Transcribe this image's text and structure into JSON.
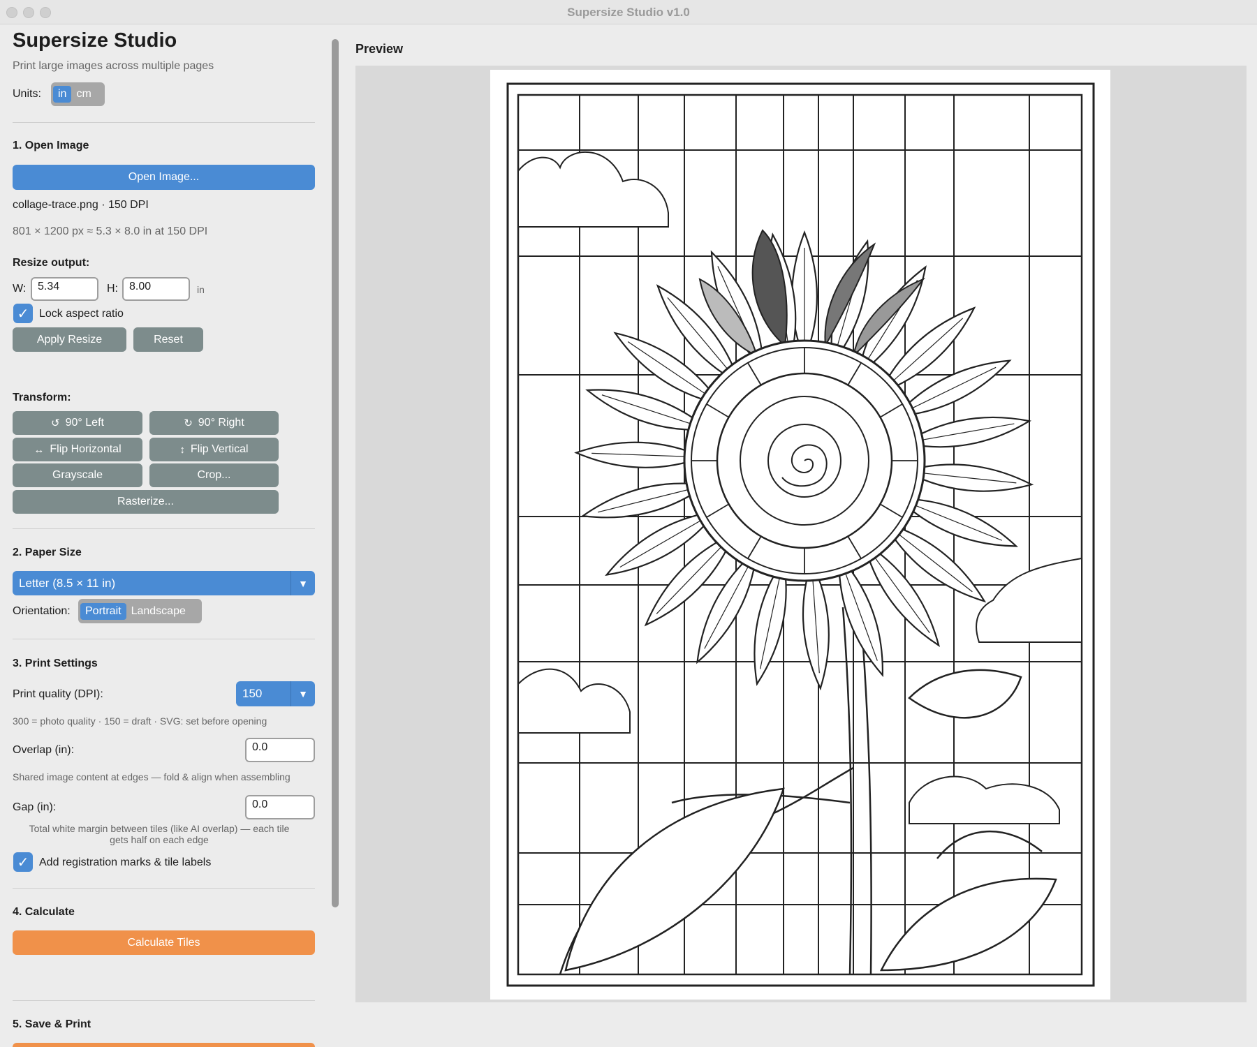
{
  "window": {
    "title": "Supersize Studio v1.0"
  },
  "app": {
    "title": "Supersize Studio",
    "subtitle": "Print large images across multiple pages"
  },
  "units": {
    "label": "Units:",
    "options": [
      "in",
      "cm"
    ],
    "selected": "in"
  },
  "open_image": {
    "section": "1.  Open Image",
    "button": "Open Image...",
    "file_info": "collage-trace.png  · 150 DPI",
    "dims_info": "801 × 1200 px  ≈  5.3 × 8.0 in  at 150 DPI",
    "resize_label": "Resize output:",
    "w_label": "W:",
    "w_value": "5.34",
    "h_label": "H:",
    "h_value": "8.00",
    "unit": "in",
    "lock_label": "Lock aspect ratio",
    "lock_checked": true,
    "apply": "Apply Resize",
    "reset": "Reset"
  },
  "transform": {
    "label": "Transform:",
    "rotate_left": "90° Left",
    "rotate_right": "90° Right",
    "flip_h": "Flip Horizontal",
    "flip_v": "Flip Vertical",
    "grayscale": "Grayscale",
    "crop": "Crop...",
    "rasterize": "Rasterize..."
  },
  "paper": {
    "section": "2.  Paper Size",
    "size": "Letter  (8.5 × 11 in)",
    "orientation_label": "Orientation:",
    "orientations": [
      "Portrait",
      "Landscape"
    ],
    "selected_orientation": "Portrait"
  },
  "print": {
    "section": "3.  Print Settings",
    "dpi_label": "Print quality (DPI):",
    "dpi_value": "150",
    "dpi_hint": "300 = photo quality   ·   150 = draft   ·   SVG: set before opening",
    "overlap_label": "Overlap (in):",
    "overlap_value": "0.0",
    "overlap_hint": "Shared image content at edges — fold & align when assembling",
    "gap_label": "Gap (in):",
    "gap_value": "0.0",
    "gap_hint_1": "Total white margin between tiles (like AI overlap) — each tile",
    "gap_hint_2": "gets half on each edge",
    "marks_label": "Add registration marks & tile labels",
    "marks_checked": true
  },
  "calculate": {
    "section": "4.  Calculate",
    "button": "Calculate Tiles"
  },
  "save": {
    "section": "5.  Save & Print"
  },
  "preview": {
    "label": "Preview"
  },
  "colors": {
    "accent": "#4a8bd4",
    "orange": "#f0914a",
    "gray_button": "#7d8c8c"
  }
}
